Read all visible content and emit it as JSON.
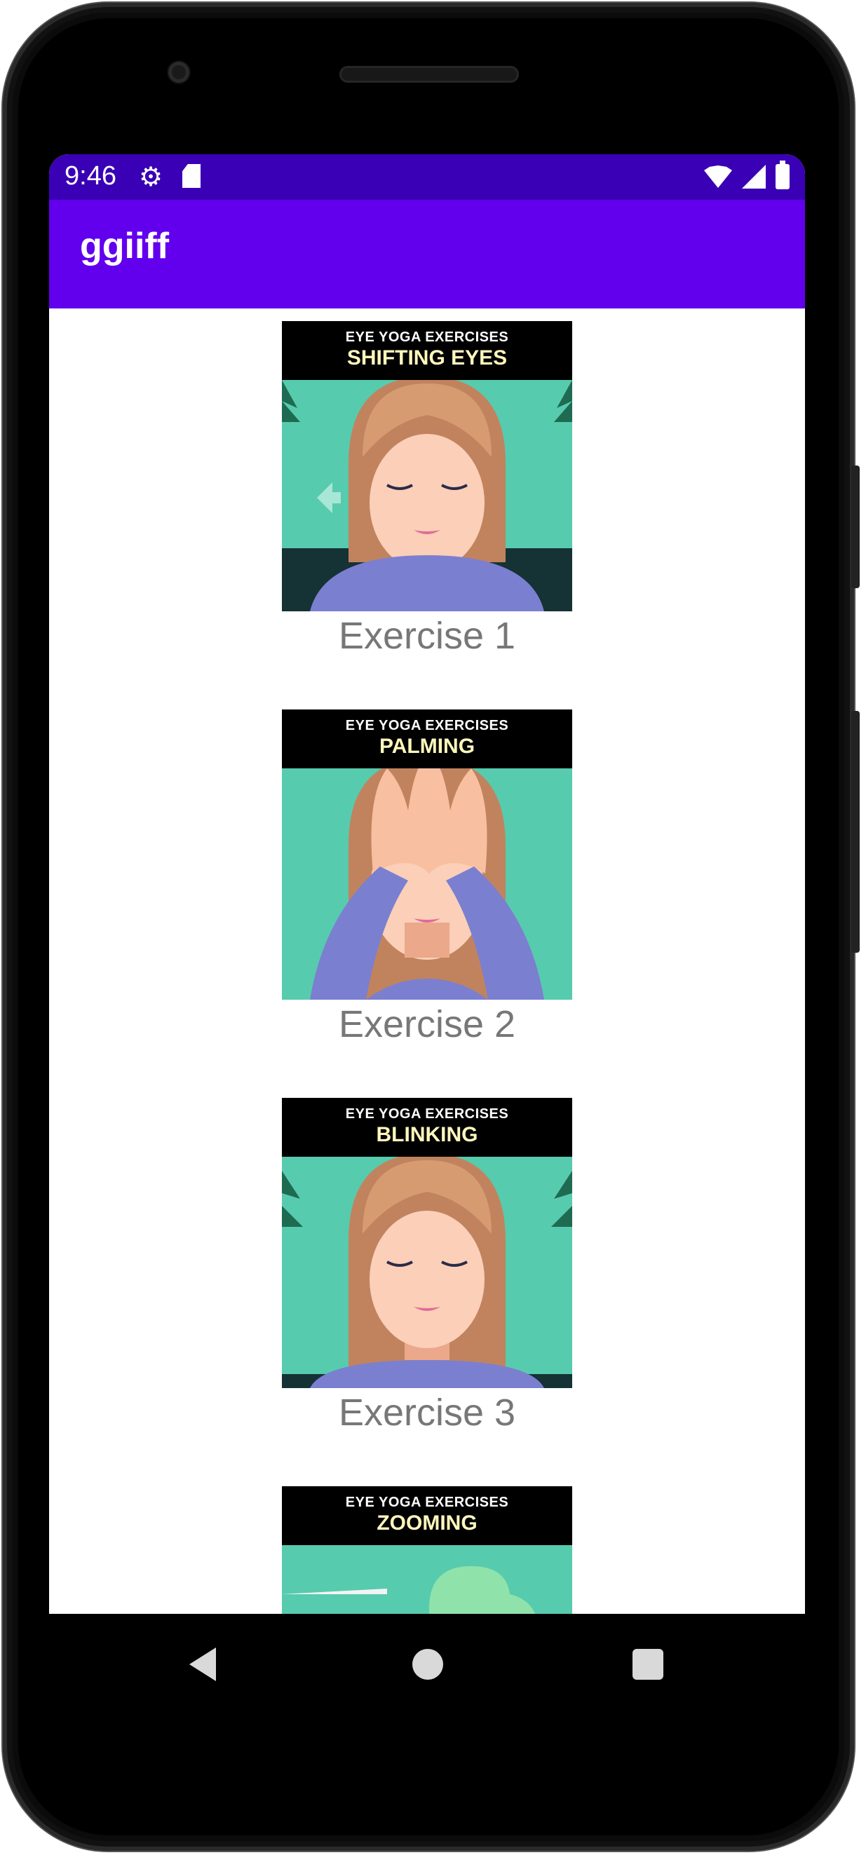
{
  "status_bar": {
    "time": "9:46",
    "icons": [
      "settings-icon",
      "sd-card-icon",
      "wifi-icon",
      "cell-signal-icon",
      "battery-icon"
    ]
  },
  "app_bar": {
    "title": "ggiiff"
  },
  "exercises": [
    {
      "header_sub": "EYE YOGA EXERCISES",
      "header_main": "SHIFTING EYES",
      "caption": "Exercise 1"
    },
    {
      "header_sub": "EYE YOGA EXERCISES",
      "header_main": "PALMING",
      "caption": "Exercise 2"
    },
    {
      "header_sub": "EYE YOGA EXERCISES",
      "header_main": "BLINKING",
      "caption": "Exercise 3"
    },
    {
      "header_sub": "EYE YOGA EXERCISES",
      "header_main": "ZOOMING"
    }
  ],
  "nav_bar": {
    "icons": [
      "back-icon",
      "home-icon",
      "recents-icon"
    ]
  },
  "colors": {
    "status_bar": "#3a00b5",
    "app_bar": "#6200ee",
    "caption_text": "#777777",
    "card_bg": "#57cbae"
  }
}
